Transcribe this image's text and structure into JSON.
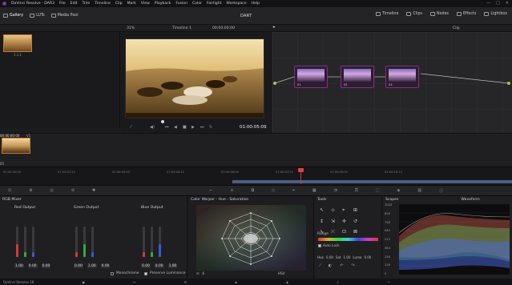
{
  "menubar": {
    "app": "DaVinci Resolve",
    "menus": [
      "DaVinci Resolve - DAR3",
      "File",
      "Edit",
      "Trim",
      "Timeline",
      "Clip",
      "Mark",
      "View",
      "Playback",
      "Fusion",
      "Color",
      "Fairlight",
      "Workspace",
      "Help"
    ]
  },
  "toolbar": {
    "gallery": "Gallery",
    "luts": "LUTs",
    "media_pool": "Media Pool",
    "project_title": "DART",
    "timeline": "Timeline",
    "clips": "Clips",
    "nodes": "Nodes",
    "effects": "Effects",
    "lightbox": "Lightbox"
  },
  "viewerbar": {
    "zoom": "31%",
    "timeline_name": "Timeline 1",
    "timecode_top": "00:00:00:00",
    "mode": "Clip"
  },
  "gallery": {
    "still_label": "1.1.1"
  },
  "viewer": {
    "timecode": "01:00:05:09"
  },
  "nodes": [
    {
      "label": "01"
    },
    {
      "label": "02"
    },
    {
      "label": "03"
    }
  ],
  "clipstrip": {
    "clip_timecode": "00:00:00:00",
    "clip_track": "V1",
    "clip_index": "05"
  },
  "timeline": {
    "ticks": [
      "01:00:00:00",
      "01:00:01:12",
      "01:00:03:00",
      "01:00:04:12",
      "01:00:06:00",
      "01:00:07:12",
      "01:00:09:00",
      "01:00:10:12"
    ]
  },
  "mixer": {
    "title": "RGB Mixer",
    "channels": [
      {
        "name": "Red Output",
        "values": [
          "1.00",
          "0.00",
          "0.00"
        ]
      },
      {
        "name": "Green Output",
        "values": [
          "0.00",
          "1.00",
          "0.00"
        ]
      },
      {
        "name": "Blue Output",
        "values": [
          "0.00",
          "0.00",
          "1.00"
        ]
      }
    ],
    "monochrome": "Monochrome",
    "preserve": "Preserve Luminance"
  },
  "warper": {
    "title": "Color Warper - Hue - Saturation",
    "hsv": "HSV",
    "grid_val": "6"
  },
  "tools": {
    "title": "Tools",
    "range": "Range",
    "auto_lock": "Auto Lock",
    "hue_label": "Hue",
    "hue_val": "0.00",
    "sat_label": "Sat",
    "sat_val": "1.00",
    "luma_label": "Luma",
    "luma_val": "0.00"
  },
  "scopes": {
    "title": "Scopes",
    "type": "Waveform",
    "scale": [
      "1023",
      "896",
      "768",
      "640",
      "512",
      "384",
      "256",
      "128",
      "0"
    ]
  },
  "footer": {
    "app": "DaVinci Resolve 18"
  },
  "colors": {
    "accent_orange": "#cb7b2d",
    "node_border": "#8a2a8a",
    "playhead": "#d23a3a"
  }
}
